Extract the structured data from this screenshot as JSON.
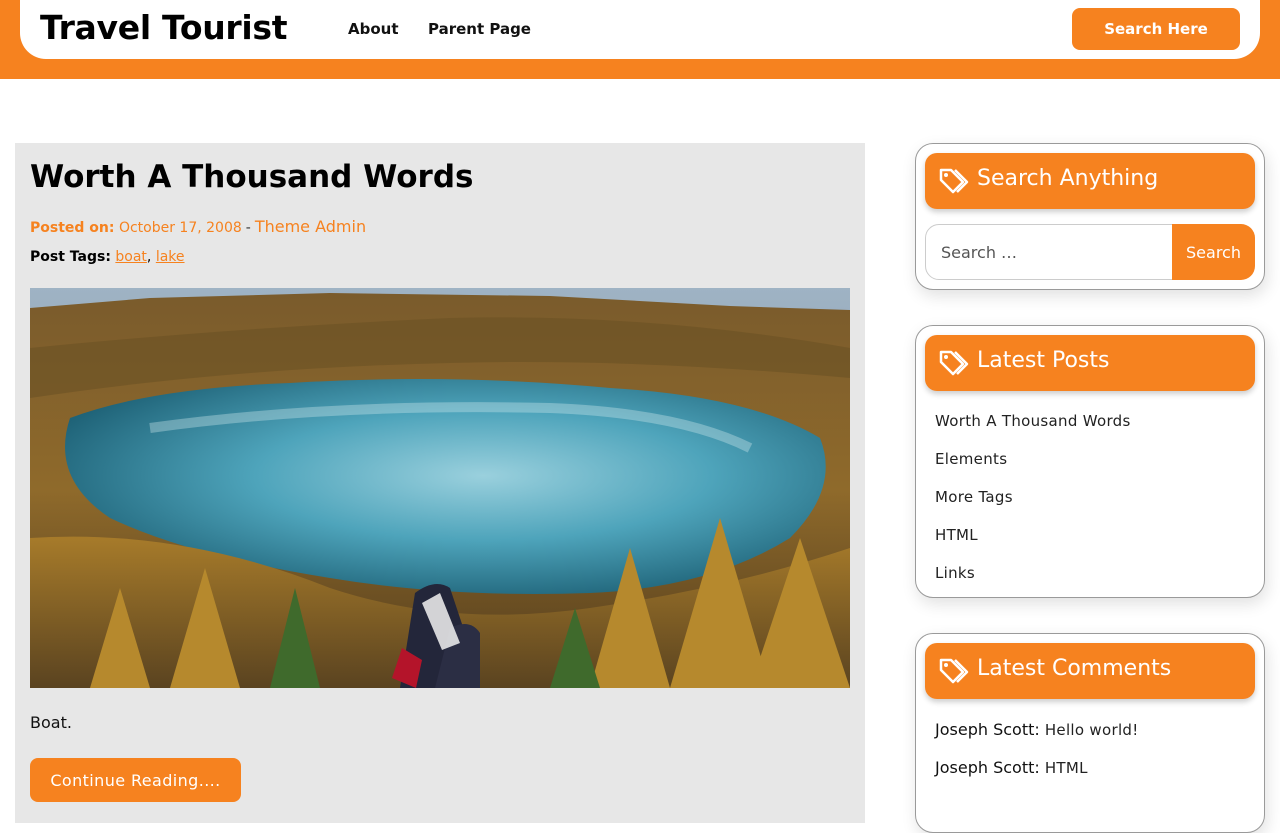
{
  "header": {
    "site_title": "Travel Tourist",
    "nav": [
      {
        "label": "About"
      },
      {
        "label": "Parent Page"
      }
    ],
    "search_button": "Search Here"
  },
  "colors": {
    "accent": "#f6821f",
    "post_background": "#e7e7e7"
  },
  "post": {
    "title": "Worth A Thousand Words",
    "posted_on_label": "Posted on:",
    "date": "October 17, 2008",
    "separator": "-",
    "author": "Theme Admin",
    "tags_label": "Post Tags:",
    "tags": [
      "boat",
      "lake"
    ],
    "tag_separator": ",",
    "image_alt": "lake-landscape",
    "excerpt": "Boat.",
    "continue_label": "Continue Reading...."
  },
  "sidebar": {
    "search_widget": {
      "title": "Search Anything",
      "placeholder": "Search …",
      "submit_label": "Search",
      "icon": "tag-icon"
    },
    "latest_posts": {
      "title": "Latest Posts",
      "icon": "tag-icon",
      "items": [
        {
          "label": "Worth A Thousand Words"
        },
        {
          "label": "Elements"
        },
        {
          "label": "More Tags"
        },
        {
          "label": "HTML"
        },
        {
          "label": "Links"
        }
      ]
    },
    "latest_comments": {
      "title": "Latest Comments",
      "icon": "tag-icon",
      "items": [
        {
          "author": "Joseph Scott:",
          "post": "Hello world!"
        },
        {
          "author": "Joseph Scott:",
          "post": "HTML"
        }
      ]
    }
  }
}
